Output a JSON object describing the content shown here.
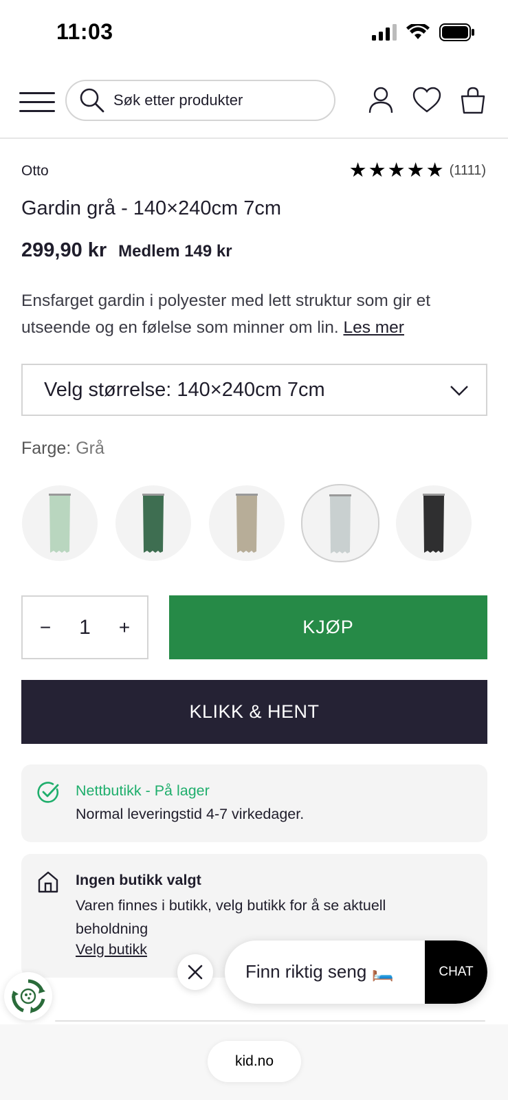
{
  "status_bar": {
    "time": "11:03"
  },
  "header": {
    "search_placeholder": "Søk etter produkter"
  },
  "product": {
    "brand": "Otto",
    "rating_count": "(1111)",
    "rating": 5,
    "title": "Gardin grå - 140×240cm 7cm",
    "price": "299,90 kr",
    "member_price": "Medlem 149 kr",
    "description": "Ensfarget gardin i polyester med lett struktur som gir et utseende og en følelse som minner om lin.",
    "read_more": "Les mer",
    "size_select": "Velg størrelse: 140×240cm 7cm",
    "color_label": "Farge:",
    "color_value": "Grå",
    "swatches": [
      {
        "color": "#b9d6bf",
        "selected": false
      },
      {
        "color": "#3e6e51",
        "selected": false
      },
      {
        "color": "#b7ad98",
        "selected": false
      },
      {
        "color": "#c9d0d0",
        "selected": true
      },
      {
        "color": "#2f2f30",
        "selected": false
      }
    ],
    "quantity": "1",
    "buy_label": "KJØP",
    "click_collect_label": "KLIKK & HENT"
  },
  "stock": {
    "online_title": "Nettbutikk - På lager",
    "online_text": "Normal leveringstid 4-7 virkedager.",
    "store_title": "Ingen butikk valgt",
    "store_text": "Varen finnes i butikk, velg butikk for å se aktuell beholdning",
    "store_link": "Velg butikk"
  },
  "promo": {
    "text": "Finn riktig seng 🛏️",
    "chat_label": "CHAT"
  },
  "browser": {
    "url": "kid.no"
  },
  "colors": {
    "buy_green": "#268a47",
    "dark_button": "#252234",
    "stock_green": "#1fae6c"
  }
}
